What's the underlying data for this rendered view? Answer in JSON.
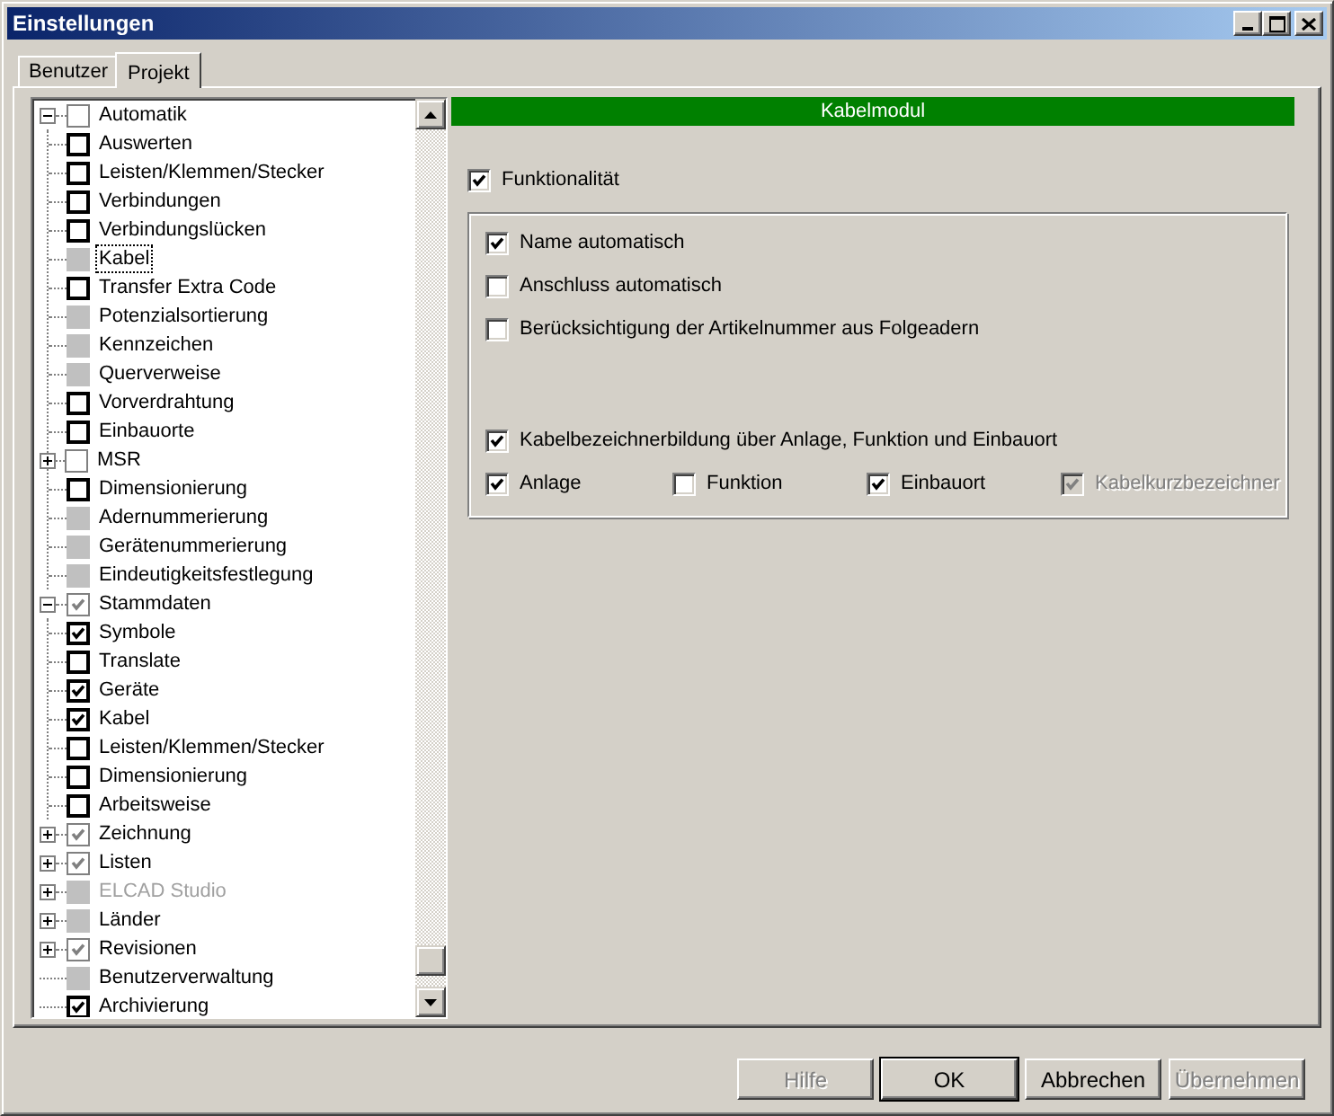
{
  "window": {
    "title": "Einstellungen"
  },
  "tabs": [
    {
      "label": "Benutzer",
      "selected": false
    },
    {
      "label": "Projekt",
      "selected": true
    }
  ],
  "tree": [
    {
      "label": "Automatik",
      "kind": "inherit",
      "checked": false,
      "selected": false,
      "disabled": false,
      "expanded": true,
      "children": [
        {
          "label": "Auswerten",
          "kind": "plain",
          "checked": false,
          "selected": false,
          "disabled": false
        },
        {
          "label": "Leisten/Klemmen/Stecker",
          "kind": "plain",
          "checked": false,
          "selected": false,
          "disabled": false
        },
        {
          "label": "Verbindungen",
          "kind": "plain",
          "checked": false,
          "selected": false,
          "disabled": false
        },
        {
          "label": "Verbindungslücken",
          "kind": "plain",
          "checked": false,
          "selected": false,
          "disabled": false
        },
        {
          "label": "Kabel",
          "kind": "blank",
          "selected": true,
          "disabled": false
        },
        {
          "label": "Transfer Extra Code",
          "kind": "plain",
          "checked": false,
          "selected": false,
          "disabled": false
        },
        {
          "label": "Potenzialsortierung",
          "kind": "blank",
          "selected": false,
          "disabled": false
        },
        {
          "label": "Kennzeichen",
          "kind": "blank",
          "selected": false,
          "disabled": false
        },
        {
          "label": "Querverweise",
          "kind": "blank",
          "selected": false,
          "disabled": false
        },
        {
          "label": "Vorverdrahtung",
          "kind": "plain",
          "checked": false,
          "selected": false,
          "disabled": false
        },
        {
          "label": "Einbauorte",
          "kind": "plain",
          "checked": false,
          "selected": false,
          "disabled": false
        },
        {
          "label": "MSR",
          "kind": "inherit",
          "checked": false,
          "selected": false,
          "disabled": false,
          "expanded": false
        },
        {
          "label": "Dimensionierung",
          "kind": "plain",
          "checked": false,
          "selected": false,
          "disabled": false
        },
        {
          "label": "Adernummerierung",
          "kind": "blank",
          "selected": false,
          "disabled": false
        },
        {
          "label": "Gerätenummerierung",
          "kind": "blank",
          "selected": false,
          "disabled": false
        },
        {
          "label": "Eindeutigkeitsfestlegung",
          "kind": "blank",
          "selected": false,
          "disabled": false
        }
      ]
    },
    {
      "label": "Stammdaten",
      "kind": "inherit",
      "checked": true,
      "selected": false,
      "disabled": false,
      "expanded": true,
      "children": [
        {
          "label": "Symbole",
          "kind": "plain",
          "checked": true,
          "selected": false,
          "disabled": false
        },
        {
          "label": "Translate",
          "kind": "plain",
          "checked": false,
          "selected": false,
          "disabled": false
        },
        {
          "label": "Geräte",
          "kind": "plain",
          "checked": true,
          "selected": false,
          "disabled": false
        },
        {
          "label": "Kabel",
          "kind": "plain",
          "checked": true,
          "selected": false,
          "disabled": false
        },
        {
          "label": "Leisten/Klemmen/Stecker",
          "kind": "plain",
          "checked": false,
          "selected": false,
          "disabled": false
        },
        {
          "label": "Dimensionierung",
          "kind": "plain",
          "checked": false,
          "selected": false,
          "disabled": false
        },
        {
          "label": "Arbeitsweise",
          "kind": "plain",
          "checked": false,
          "selected": false,
          "disabled": false
        }
      ]
    },
    {
      "label": "Zeichnung",
      "kind": "inherit",
      "checked": true,
      "selected": false,
      "disabled": false,
      "expanded": false
    },
    {
      "label": "Listen",
      "kind": "inherit",
      "checked": true,
      "selected": false,
      "disabled": false,
      "expanded": false
    },
    {
      "label": "ELCAD Studio",
      "kind": "blank",
      "selected": false,
      "disabled": true,
      "expanded": false
    },
    {
      "label": "Länder",
      "kind": "blank",
      "selected": false,
      "disabled": false,
      "expanded": false
    },
    {
      "label": "Revisionen",
      "kind": "inherit",
      "checked": true,
      "selected": false,
      "disabled": false,
      "expanded": false
    },
    {
      "label": "Benutzerverwaltung",
      "kind": "blank",
      "selected": false,
      "disabled": false
    },
    {
      "label": "Archivierung",
      "kind": "plain",
      "checked": true,
      "selected": false,
      "disabled": false
    }
  ],
  "panel": {
    "title": "Kabelmodul",
    "functionality": {
      "label": "Funktionalität",
      "checked": true
    },
    "options": [
      {
        "label": "Name automatisch",
        "checked": true
      },
      {
        "label": "Anschluss automatisch",
        "checked": false
      },
      {
        "label": "Berücksichtigung der Artikelnummer aus Folgeadern",
        "checked": false
      }
    ],
    "naming": {
      "label": "Kabelbezeichnerbildung über Anlage, Funktion und Einbauort",
      "checked": true
    },
    "parts": [
      {
        "label": "Anlage",
        "checked": true,
        "disabled": false
      },
      {
        "label": "Funktion",
        "checked": false,
        "disabled": false
      },
      {
        "label": "Einbauort",
        "checked": true,
        "disabled": false
      },
      {
        "label": "Kabelkurzbezeichner",
        "checked": true,
        "disabled": true
      }
    ]
  },
  "buttons": [
    {
      "label": "Hilfe",
      "disabled": true,
      "default": false
    },
    {
      "label": "OK",
      "disabled": false,
      "default": true
    },
    {
      "label": "Abbrechen",
      "disabled": false,
      "default": false
    },
    {
      "label": "Übernehmen",
      "disabled": true,
      "default": false
    }
  ]
}
